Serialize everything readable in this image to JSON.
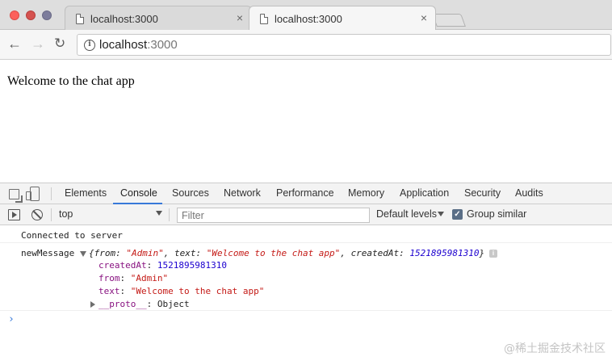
{
  "browser": {
    "tabs": [
      {
        "title": "localhost:3000",
        "active": false
      },
      {
        "title": "localhost:3000",
        "active": true
      }
    ],
    "tab_close_glyph": "×",
    "omnibox": {
      "host": "localhost",
      "port": ":3000"
    }
  },
  "page": {
    "heading": "Welcome to the chat app"
  },
  "devtools": {
    "tabs": [
      "Elements",
      "Console",
      "Sources",
      "Network",
      "Performance",
      "Memory",
      "Application",
      "Security",
      "Audits"
    ],
    "active_tab": "Console",
    "toolbar": {
      "context": "top",
      "filter_placeholder": "Filter",
      "levels": "Default levels",
      "group_similar": "Group similar",
      "group_similar_checked": true
    },
    "console": {
      "log1": "Connected to server",
      "log2_label": "newMessage",
      "summary": {
        "open": "{",
        "from_key": "from",
        "from_val": "\"Admin\"",
        "text_key": "text",
        "text_val": "\"Welcome to the chat app\"",
        "createdAt_key": "createdAt",
        "createdAt_val": "1521895981310",
        "close": "}"
      },
      "props": [
        {
          "key": "createdAt",
          "value": "1521895981310",
          "type": "number"
        },
        {
          "key": "from",
          "value": "\"Admin\"",
          "type": "string"
        },
        {
          "key": "text",
          "value": "\"Welcome to the chat app\"",
          "type": "string"
        }
      ],
      "proto_key": "__proto__",
      "proto_val": "Object",
      "prompt": "›"
    },
    "accent_color": "#3879d9"
  },
  "watermark": "@稀土掘金技术社区"
}
